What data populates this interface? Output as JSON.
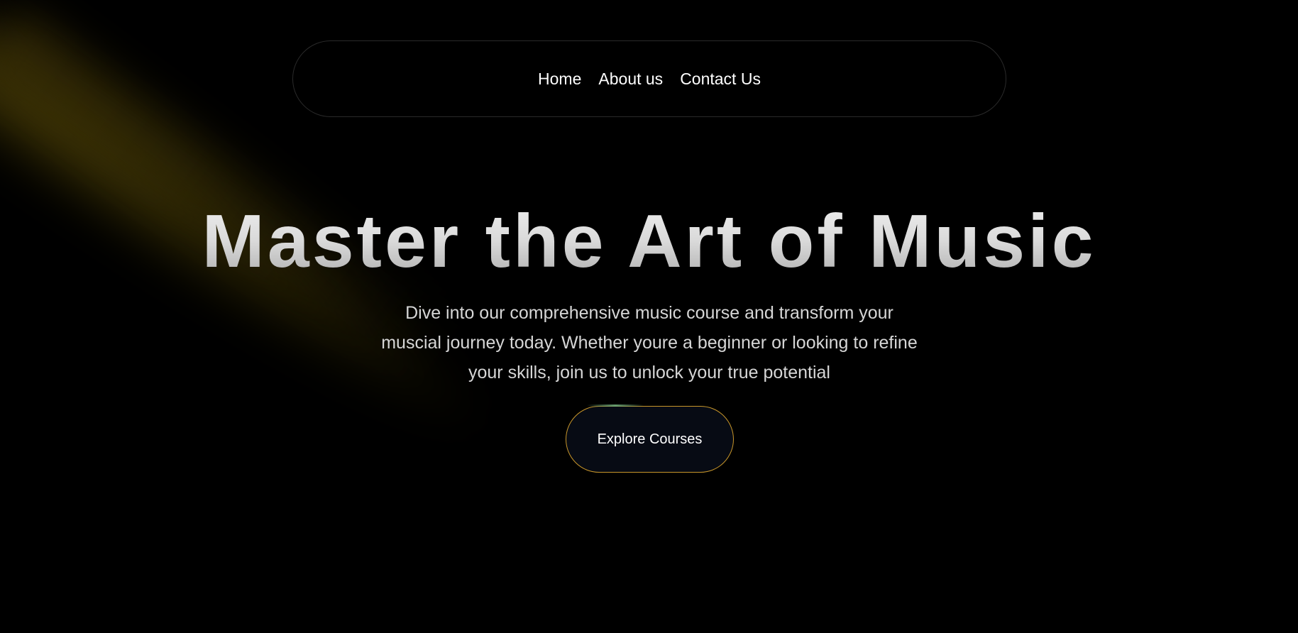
{
  "nav": {
    "items": [
      {
        "label": "Home"
      },
      {
        "label": "About us"
      },
      {
        "label": "Contact Us"
      }
    ]
  },
  "hero": {
    "title": "Master the Art of Music",
    "subtitle": "Dive into our comprehensive music course and transform your muscial journey today. Whether youre a beginner or looking to refine your skills, join us to unlock your true potential",
    "cta_label": "Explore Courses"
  },
  "colors": {
    "background": "#000000",
    "spotlight": "#5a4b05",
    "cta_border": "#c8962a",
    "cta_background": "#070b14",
    "title_gradient_top": "#f1f1f1",
    "title_gradient_bottom": "#a8a8a8"
  }
}
